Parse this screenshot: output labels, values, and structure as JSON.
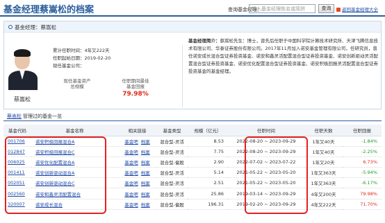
{
  "header": {
    "title": "基金经理蔡嵩松的档案",
    "search_label": "查询基金经理：",
    "search_placeholder": "输入基金经理姓名或简拼",
    "search_button": "查询",
    "return_link": "返回基金经理大全"
  },
  "manager": {
    "section_title": "基金经理：蔡嵩松",
    "name": "蔡嵩松",
    "tenure": "累计任职时间：4年又222天",
    "start_date": "任职起始日期：2019-02-20",
    "company": "现任基金公司：",
    "assets_label": "现任基金资产\n总规模",
    "return_label": "任职期间最佳\n基金回报",
    "best_return": "79.98%",
    "bio_title": "基金经理简介：",
    "bio_text": "蔡嵩松先生：博士，曾先后任职于中国科学院计算技术研究所、天津飞腾信息技术有限公司、华泰证券股份有限公司。2017年11月加入诺安基金管理有限公司，任研究员，曾任诺安成长混合型证券投资基金、诺安和鑫灵活配置混合型证券投资基金、诺安创新驱动灵活配置混合型证券投资基金、诺安优化配置混合型证券投资基金、诺安积极回报灵活配置混合型证券投资基金的基金经理。"
  },
  "history": {
    "manager_link": "蔡嵩松",
    "title_rest": "管理过的基金一览"
  },
  "table": {
    "headers": [
      "基金代码",
      "基金名称",
      "相关链接",
      "基金类型",
      "规模（亿元）",
      "任职时间",
      "任职天数",
      "任职回报"
    ],
    "link_a": "基金吧",
    "link_b": "档案",
    "rows": [
      {
        "code": "001706",
        "name": "诺安积极回报混合A",
        "type": "混合型-灵活",
        "size": "8.53",
        "period": "2022-08-20 ~ 2023-09-29",
        "days": "1年又40天",
        "ret": "-1.84%",
        "sign": "neg"
      },
      {
        "code": "012847",
        "name": "诺安积极回报混合C",
        "type": "混合型-灵活",
        "size": "7.75",
        "period": "2022-08-20 ~ 2023-09-29",
        "days": "1年又40天",
        "ret": "-2.25%",
        "sign": "neg"
      },
      {
        "code": "006025",
        "name": "诺安优化配置混合A",
        "type": "混合型-偏股",
        "size": "2.90",
        "period": "2022-07-02 ~ 2023-07-22",
        "days": "1年又20天",
        "ret": "6.73%",
        "sign": "pos"
      },
      {
        "code": "001411",
        "name": "诺安创新驱动混合A",
        "type": "混合型-灵活",
        "size": "5.14",
        "period": "2021-05-22 ~ 2023-05-20",
        "days": "1年又363天",
        "ret": "-5.94%",
        "sign": "neg"
      },
      {
        "code": "002051",
        "name": "诺安创新驱动混合C",
        "type": "混合型-灵活",
        "size": "2.51",
        "period": "2021-05-22 ~ 2023-05-20",
        "days": "1年又363天",
        "ret": "-6.17%",
        "sign": "neg"
      },
      {
        "code": "002560",
        "name": "诺安和鑫灵活配置混合",
        "type": "混合型-灵活",
        "size": "25.86",
        "period": "2019-03-14 ~ 2023-09-29",
        "days": "4年又200天",
        "ret": "79.98%",
        "sign": "pos"
      },
      {
        "code": "320007",
        "name": "诺安成长混合",
        "type": "混合型-偏股",
        "size": "196.31",
        "period": "2019-02-20 ~ 2023-09-29",
        "days": "4年又222天",
        "ret": "71.70%",
        "sign": "pos"
      }
    ]
  },
  "colors": {
    "accent": "#2a5e9c",
    "highlight": "#e32020",
    "positive": "#e0271a",
    "negative": "#1a9c2c"
  }
}
